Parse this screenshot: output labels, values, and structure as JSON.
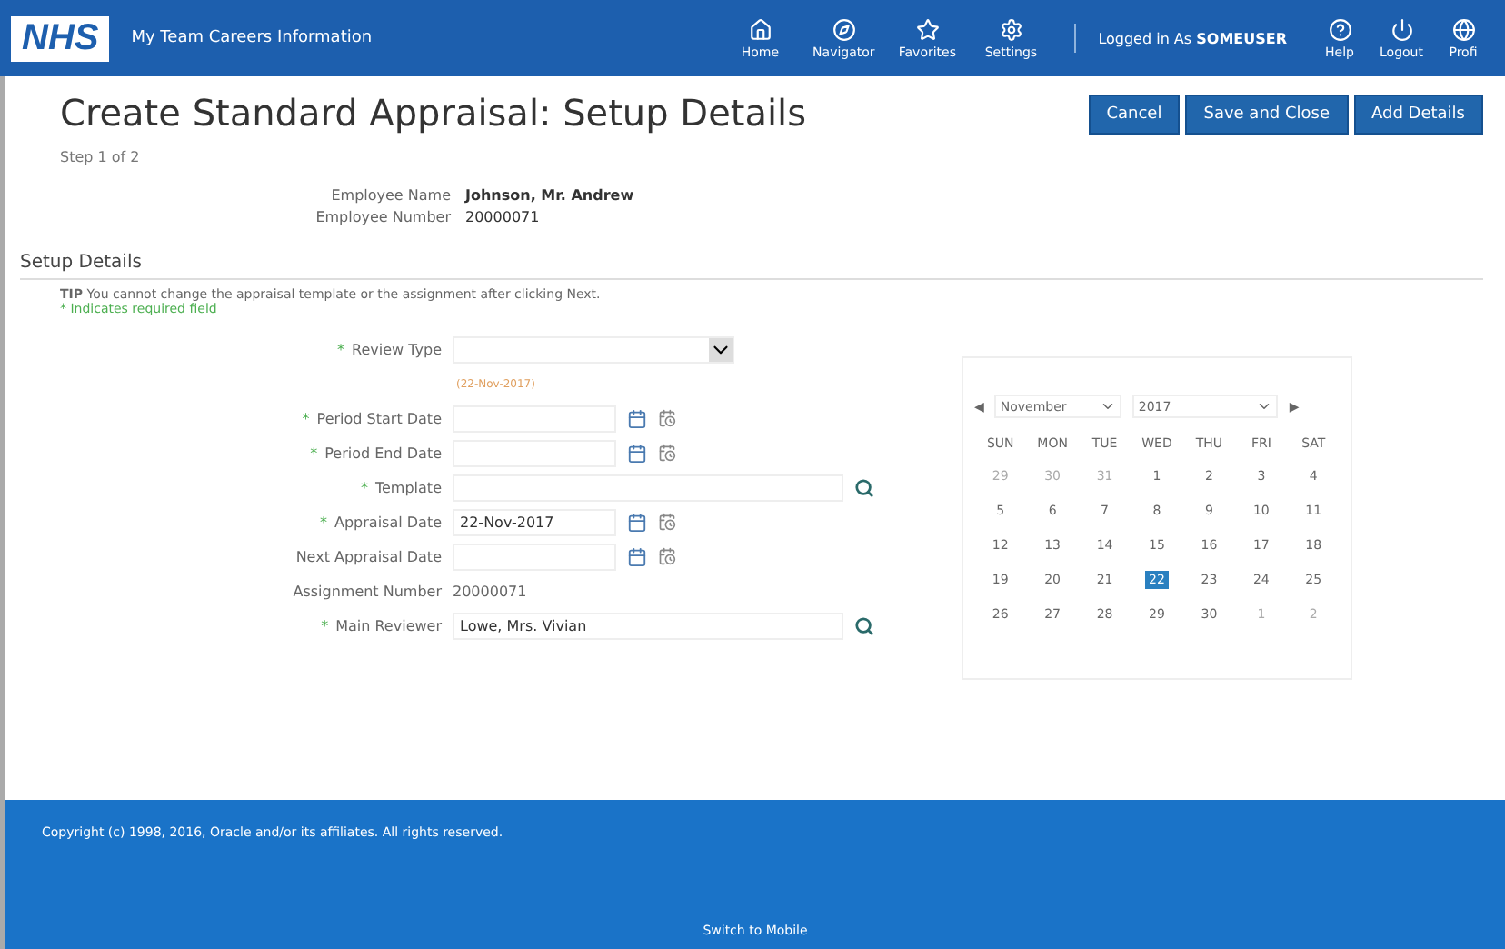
{
  "header": {
    "logo": "NHS",
    "app_title": "My Team Careers Information",
    "nav": [
      {
        "kind": "home",
        "label": "Home"
      },
      {
        "kind": "compass",
        "label": "Navigator"
      },
      {
        "kind": "star",
        "label": "Favorites"
      },
      {
        "kind": "gear",
        "label": "Settings"
      }
    ],
    "logged_in_label": "Logged in As",
    "user": "SOMEUSER",
    "actions": [
      {
        "kind": "help",
        "label": "Help"
      },
      {
        "kind": "power",
        "label": "Logout"
      },
      {
        "kind": "globe",
        "label": "Profi"
      }
    ]
  },
  "page": {
    "title": "Create Standard Appraisal: Setup Details",
    "step": "Step 1 of 2",
    "buttons": [
      "Cancel",
      "Save and Close",
      "Add Details"
    ]
  },
  "employee": [
    {
      "label": "Employee Name",
      "value": "Johnson, Mr. Andrew",
      "bold": true
    },
    {
      "label": "Employee Number",
      "value": "20000071",
      "bold": false
    }
  ],
  "section": {
    "title": "Setup Details",
    "tip_label": "TIP",
    "tip": "You cannot change the appraisal template or the assignment after clicking Next.",
    "required_note": "* Indicates required field"
  },
  "fields": [
    {
      "kind": "select",
      "label": "Review Type",
      "required_mark": "*",
      "hint": "(22-Nov-2017)"
    },
    {
      "kind": "date",
      "label": "Period Start Date",
      "required_mark": "*"
    },
    {
      "kind": "date",
      "label": "Period End Date",
      "required_mark": "*"
    },
    {
      "kind": "lookup",
      "label": "Template",
      "required_mark": "*"
    },
    {
      "kind": "date",
      "label": "Appraisal Date",
      "required_mark": "*",
      "value": "22-Nov-2017"
    },
    {
      "kind": "date",
      "label": "Next Appraisal Date"
    },
    {
      "kind": "text",
      "label": "Assignment Number",
      "value": "20000071"
    },
    {
      "kind": "lookup",
      "label": "Main Reviewer",
      "required_mark": "*",
      "value": "Lowe, Mrs. Vivian"
    }
  ],
  "calendar": {
    "prev": "◀",
    "month": "November",
    "year": "2017",
    "next": "▶",
    "weekdays": [
      "SUN",
      "MON",
      "TUE",
      "WED",
      "THU",
      "FRI",
      "SAT"
    ],
    "weeks": [
      [
        {
          "day": "29",
          "outside": true,
          "selected": false
        },
        {
          "day": "30",
          "outside": true,
          "selected": false
        },
        {
          "day": "31",
          "outside": true,
          "selected": false
        },
        {
          "day": "1",
          "outside": false,
          "selected": false
        },
        {
          "day": "2",
          "outside": false,
          "selected": false
        },
        {
          "day": "3",
          "outside": false,
          "selected": false
        },
        {
          "day": "4",
          "outside": false,
          "selected": false
        }
      ],
      [
        {
          "day": "5",
          "outside": false,
          "selected": false
        },
        {
          "day": "6",
          "outside": false,
          "selected": false
        },
        {
          "day": "7",
          "outside": false,
          "selected": false
        },
        {
          "day": "8",
          "outside": false,
          "selected": false
        },
        {
          "day": "9",
          "outside": false,
          "selected": false
        },
        {
          "day": "10",
          "outside": false,
          "selected": false
        },
        {
          "day": "11",
          "outside": false,
          "selected": false
        }
      ],
      [
        {
          "day": "12",
          "outside": false,
          "selected": false
        },
        {
          "day": "13",
          "outside": false,
          "selected": false
        },
        {
          "day": "14",
          "outside": false,
          "selected": false
        },
        {
          "day": "15",
          "outside": false,
          "selected": false
        },
        {
          "day": "16",
          "outside": false,
          "selected": false
        },
        {
          "day": "17",
          "outside": false,
          "selected": false
        },
        {
          "day": "18",
          "outside": false,
          "selected": false
        }
      ],
      [
        {
          "day": "19",
          "outside": false,
          "selected": false
        },
        {
          "day": "20",
          "outside": false,
          "selected": false
        },
        {
          "day": "21",
          "outside": false,
          "selected": false
        },
        {
          "day": "22",
          "outside": false,
          "selected": true
        },
        {
          "day": "23",
          "outside": false,
          "selected": false
        },
        {
          "day": "24",
          "outside": false,
          "selected": false
        },
        {
          "day": "25",
          "outside": false,
          "selected": false
        }
      ],
      [
        {
          "day": "26",
          "outside": false,
          "selected": false
        },
        {
          "day": "27",
          "outside": false,
          "selected": false
        },
        {
          "day": "28",
          "outside": false,
          "selected": false
        },
        {
          "day": "29",
          "outside": false,
          "selected": false
        },
        {
          "day": "30",
          "outside": false,
          "selected": false
        },
        {
          "day": "1",
          "outside": true,
          "selected": false
        },
        {
          "day": "2",
          "outside": true,
          "selected": false
        }
      ]
    ]
  },
  "footer": {
    "copyright": "Copyright (c) 1998, 2016, Oracle and/or its affiliates. All rights reserved.",
    "switch_link": "Switch to Mobile"
  }
}
